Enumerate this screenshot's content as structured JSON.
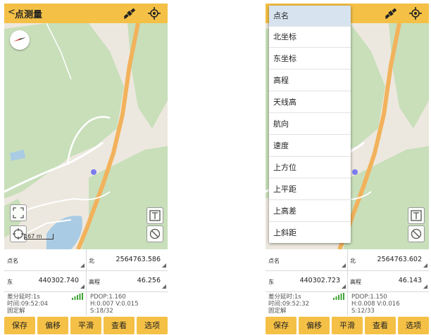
{
  "screens": [
    {
      "header": {
        "back_glyph": "<",
        "title": "点测量",
        "icons": [
          "satellite-icon",
          "gps-icon"
        ]
      },
      "map": {
        "scale_label": "167 m",
        "controls": [
          "compass-icon",
          "fullscreen-icon",
          "locate-icon",
          "text-icon",
          "no-icon"
        ]
      },
      "fields": {
        "point_name": {
          "label": "点名",
          "value": ""
        },
        "north": {
          "label": "北",
          "value": "2564763.586"
        },
        "east": {
          "label": "东",
          "value": "440302.740"
        },
        "elevation": {
          "label": "高程",
          "value": "46.256"
        }
      },
      "status": {
        "diff_delay": "差分延时:1s",
        "time": "时间:09:52:04",
        "solution": "固定解",
        "pdop": "PDOP:1.160",
        "hv": "H:0.007  V:0.015",
        "sats": "S:18/32"
      },
      "buttons": [
        "保存",
        "偏移",
        "平滑",
        "查看",
        "选项"
      ]
    },
    {
      "header": {
        "back_glyph": "<",
        "title": "",
        "icons": [
          "satellite-icon",
          "gps-icon"
        ]
      },
      "dropdown": {
        "items": [
          "点名",
          "北坐标",
          "东坐标",
          "高程",
          "天线高",
          "航向",
          "速度",
          "上方位",
          "上平距",
          "上高差",
          "上斜距"
        ],
        "selected_index": 0
      },
      "fields": {
        "point_name": {
          "label": "点名",
          "value": ""
        },
        "north": {
          "label": "北",
          "value": "2564763.602"
        },
        "east": {
          "label": "东",
          "value": "440302.723"
        },
        "elevation": {
          "label": "高程",
          "value": "46.143"
        }
      },
      "status": {
        "diff_delay": "差分延时:1s",
        "time": "时间:09:52:32",
        "solution": "固定解",
        "pdop": "PDOP:1.150",
        "hv": "H:0.008  V:0.016",
        "sats": "S:12/33"
      },
      "buttons": [
        "保存",
        "偏移",
        "平滑",
        "查看",
        "选项"
      ]
    }
  ],
  "colors": {
    "accent": "#f4c046",
    "map_land": "#ede8df",
    "map_green": "#c8dfba",
    "road": "#f2b25c",
    "water": "#a9cbe3",
    "signal": "#3fa535"
  }
}
